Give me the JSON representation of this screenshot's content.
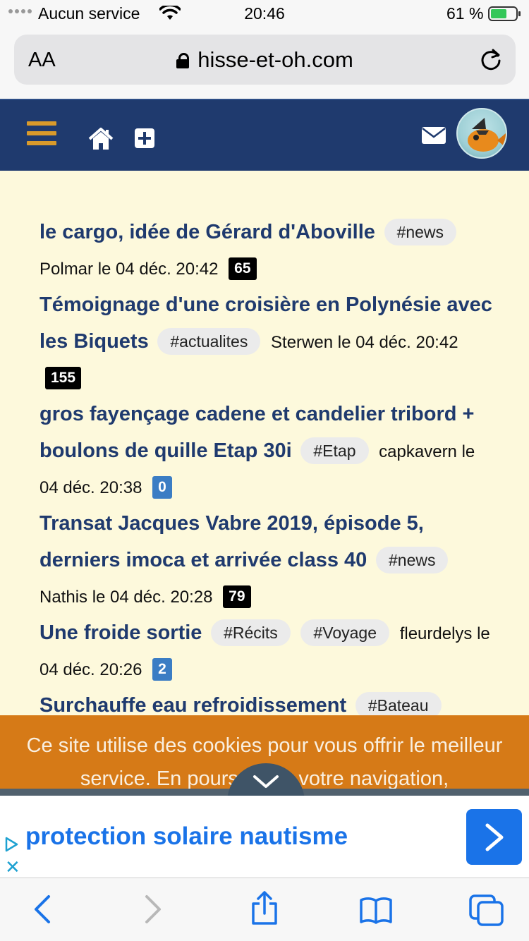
{
  "status_bar": {
    "carrier": "Aucun service",
    "time": "20:46",
    "battery_percent": "61 %"
  },
  "browser": {
    "text_size_label": "AA",
    "url": "hisse-et-oh.com"
  },
  "site_header": {
    "colors": {
      "background": "#1f3a6e",
      "menu_accent": "#d99a2b"
    }
  },
  "topics": [
    {
      "title": "le cargo, idée de Gérard d'Aboville",
      "tags": [
        "#news"
      ],
      "meta": "Polmar le 04 déc. 20:42",
      "count": "65",
      "count_style": "dark"
    },
    {
      "title": "Témoignage d'une croisière en Polynésie avec les Biquets",
      "tags": [
        "#actualites"
      ],
      "meta": "Sterwen le 04 déc. 20:42",
      "count": "155",
      "count_style": "dark"
    },
    {
      "title": "gros fayençage cadene et candelier tribord + boulons de quille Etap 30i",
      "tags": [
        "#Etap"
      ],
      "meta": "capkavern le 04 déc. 20:38",
      "count": "0",
      "count_style": "blue"
    },
    {
      "title": "Transat Jacques Vabre 2019, épisode 5, derniers imoca et arrivée class 40",
      "tags": [
        "#news"
      ],
      "meta": "Nathis le 04 déc. 20:28",
      "count": "79",
      "count_style": "dark"
    },
    {
      "title": "Une froide sortie",
      "tags": [
        "#Récits",
        "#Voyage"
      ],
      "meta": "fleurdelys le 04 déc. 20:26",
      "count": "2",
      "count_style": "blue"
    },
    {
      "title": "Surchauffe eau refroidissement",
      "tags": [
        "#Bateau"
      ],
      "meta": "",
      "count": "",
      "count_style": "dark"
    }
  ],
  "cookie_banner": {
    "text": "Ce site utilise des cookies pour vous offrir le meilleur service. En poursuivant votre navigation,"
  },
  "ad": {
    "text": "protection solaire nautisme",
    "close_label": "✕"
  },
  "icons": {
    "menu": "hamburger-icon",
    "home": "home-icon",
    "add": "plus-square-icon",
    "mail": "envelope-icon",
    "back": "chevron-left-icon",
    "forward": "chevron-right-icon",
    "share": "share-icon",
    "bookmarks": "book-icon",
    "tabs": "tabs-icon"
  }
}
